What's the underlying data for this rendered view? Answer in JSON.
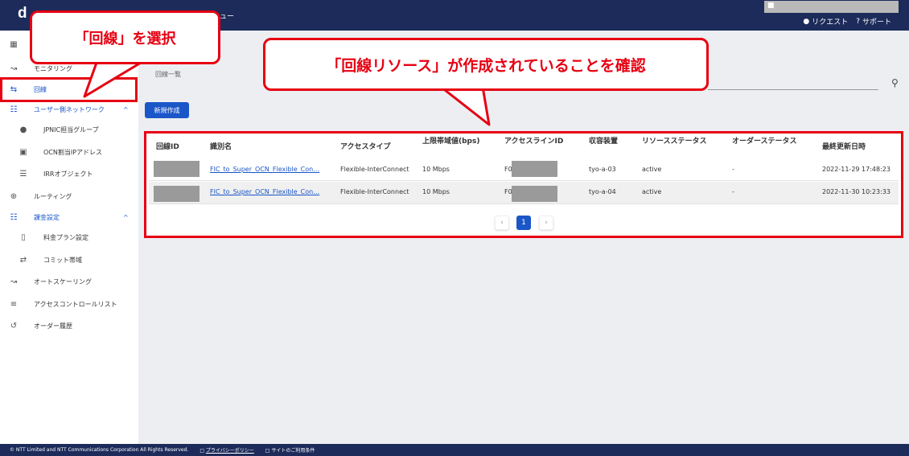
{
  "header": {
    "logo": "d",
    "menu_fragment": "ュー",
    "user_icon": "user-icon",
    "links": [
      "リクエスト",
      "サポート"
    ]
  },
  "sidebar": {
    "items": [
      {
        "label": "",
        "icon": "dashboard-icon"
      },
      {
        "label": "モニタリング",
        "icon": "chart-line-icon"
      },
      {
        "label": "回線",
        "icon": "line-icon",
        "active": true
      },
      {
        "label": "ユーザー側ネットワーク",
        "icon": "network-icon"
      },
      {
        "label": "JPNIC担当グループ",
        "icon": "person-icon"
      },
      {
        "label": "OCN割当IPアドレス",
        "icon": "monitor-icon"
      },
      {
        "label": "IRRオブジェクト",
        "icon": "database-icon"
      },
      {
        "label": "ルーティング",
        "icon": "routing-icon"
      },
      {
        "label": "課金設定",
        "icon": "network-icon"
      },
      {
        "label": "料金プラン設定",
        "icon": "plan-icon"
      },
      {
        "label": "コミット帯域",
        "icon": "commit-icon"
      },
      {
        "label": "オートスケーリング",
        "icon": "autoscale-icon"
      },
      {
        "label": "アクセスコントロールリスト",
        "icon": "list-icon"
      },
      {
        "label": "オーダー履歴",
        "icon": "history-icon"
      }
    ]
  },
  "main": {
    "breadcrumb": "回線一覧",
    "new_button": "新規作成",
    "table": {
      "headers": [
        "回線ID",
        "識別名",
        "アクセスタイプ",
        "上限帯域値(bps)",
        "アクセスラインID",
        "収容装置",
        "リソースステータス",
        "オーダーステータス",
        "最終更新日時"
      ],
      "rows": [
        {
          "name": "FIC_to_Super_OCN_Flexible_Con…",
          "access_type": "Flexible-InterConnect",
          "bandwidth": "10 Mbps",
          "line_id_prefix": "F0",
          "device": "tyo-a-03",
          "resource_status": "active",
          "order_status": "-",
          "updated": "2022-11-29 17:48:23"
        },
        {
          "name": "FIC_to_Super_OCN_Flexible_Con…",
          "access_type": "Flexible-InterConnect",
          "bandwidth": "10 Mbps",
          "line_id_prefix": "F0",
          "device": "tyo-a-04",
          "resource_status": "active",
          "order_status": "-",
          "updated": "2022-11-30 10:23:33"
        }
      ]
    },
    "pagination": {
      "prev": "‹",
      "current": "1",
      "next": "›"
    }
  },
  "footer": {
    "copyright": "© NTT Limited and NTT Communications Corporation All Rights Reserved.",
    "privacy": "プライバシーポリシー",
    "terms": "サイトのご利用条件"
  },
  "callouts": {
    "select_line": "「回線」を選択",
    "confirm_resource": "「回線リソース」が作成されていることを確認"
  },
  "colors": {
    "accent": "#1a56c8",
    "header": "#1c2b5a",
    "annotation": "#e60012"
  }
}
